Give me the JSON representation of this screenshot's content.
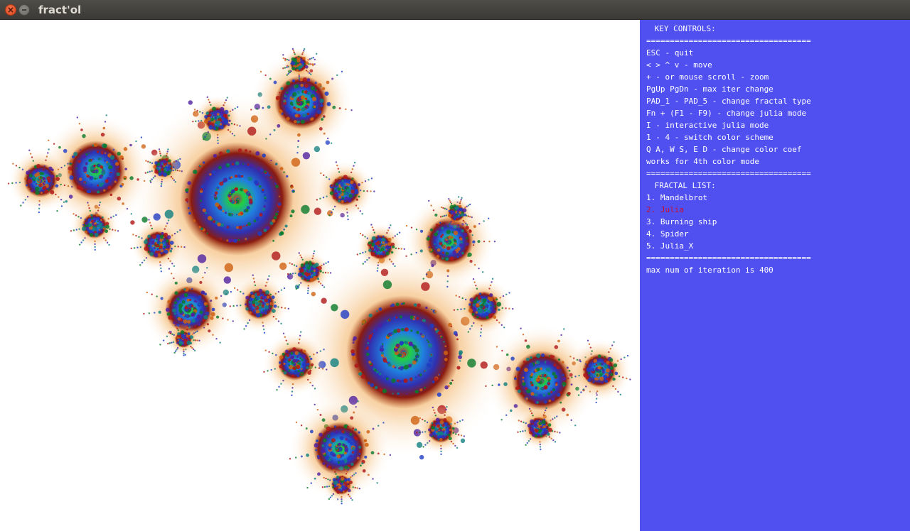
{
  "window": {
    "title": "fract'ol",
    "buttons": [
      "close-icon",
      "minimize-icon"
    ]
  },
  "colors": {
    "panel_bg": "#5050f0",
    "panel_text": "#ffffff",
    "active_item": "#c8102e",
    "titlebar": "#46453f"
  },
  "controls": {
    "header": " KEY CONTROLS:",
    "separator": "===================================",
    "items": [
      "ESC - quit",
      "< > ^ v - move",
      "+ - or mouse scroll - zoom",
      "PgUp PgDn - max iter change",
      "PAD_1 - PAD_5 - change fractal type",
      "Fn + (F1 - F9) - change julia mode",
      "I - interactive julia mode",
      "1 - 4 - switch color scheme",
      "Q A, W S, E D - change color coef",
      "works for 4th color mode"
    ]
  },
  "fractals": {
    "header": " FRACTAL LIST:",
    "items": [
      "1. Mandelbrot",
      "2. Julia",
      "3. Burning ship",
      "4. Spider",
      "5. Julia_X"
    ],
    "active_index": 1
  },
  "status": {
    "max_iter_text": "max num of iteration is 400"
  }
}
